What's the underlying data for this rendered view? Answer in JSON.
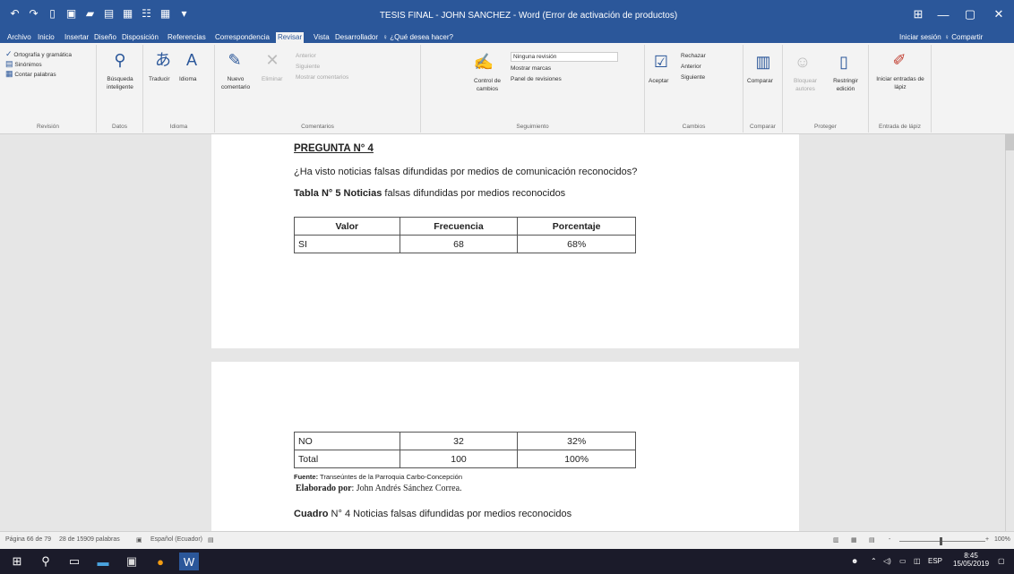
{
  "window": {
    "title": "TESIS FINAL - JOHN SÁNCHEZ - Word (Error de activación de productos)",
    "minimize": "—",
    "maximize": "▢",
    "close": "✕",
    "ribbon_display": "⊞"
  },
  "qat": [
    "5",
    "·",
    "◯",
    "▢",
    "⤺",
    "▪",
    "▪",
    "▤",
    "▤",
    "▤",
    "▾"
  ],
  "tabs": [
    {
      "label": "Archivo"
    },
    {
      "label": "Inicio"
    },
    {
      "label": "Insertar"
    },
    {
      "label": "Diseño"
    },
    {
      "label": "Disposición"
    },
    {
      "label": "Referencias"
    },
    {
      "label": "Correspondencia"
    },
    {
      "label": "Revisar",
      "active": true
    },
    {
      "label": "Vista"
    },
    {
      "label": "Desarrollador"
    },
    {
      "label": "♀ ¿Qué desea hacer?"
    }
  ],
  "account": {
    "signin": "Iniciar sesión",
    "share": "♀ Compartir"
  },
  "ribbon": {
    "revision": {
      "label": "Revisión",
      "spelling": "Ortografía y gramática",
      "thesaurus": "Sinónimos",
      "word_count": "Contar palabras"
    },
    "ideas": {
      "label": "Datos",
      "smart_lookup": "Búsqueda inteligente"
    },
    "language": {
      "label": "Idioma",
      "translate": "Traducir",
      "language": "Idioma"
    },
    "comments": {
      "label": "Comentarios",
      "new": "Nuevo comentario",
      "delete": "Eliminar",
      "previous": "Anterior",
      "next": "Siguiente",
      "show": "Mostrar comentarios"
    },
    "tracking": {
      "label": "Seguimiento",
      "track_changes": "Control de cambios",
      "markup_select": "Ninguna revisión",
      "show_markup": "Mostrar marcas",
      "reviewing_pane": "Panel de revisiones"
    },
    "changes": {
      "label": "Cambios",
      "accept": "Aceptar",
      "reject": "Rechazar",
      "previous": "Anterior",
      "next": "Siguiente"
    },
    "compare": {
      "label": "Comparar",
      "compare": "Comparar"
    },
    "protect": {
      "label": "Proteger",
      "block_authors": "Bloquear autores",
      "restrict": "Restringir edición"
    },
    "ink": {
      "label": "Entrada de lápiz",
      "start_ink": "Iniciar entradas de lápiz"
    }
  },
  "document": {
    "page1": {
      "heading": "PREGUNTA N° 4",
      "question": "¿Ha visto noticias falsas difundidas por medios de comunicación reconocidos?",
      "caption_bold": "Tabla N° 5 Noticias",
      "caption_rest": " falsas difundidas por medios reconocidos",
      "table": {
        "headers": [
          "Valor",
          "Frecuencia",
          "Porcentaje"
        ],
        "rows": [
          [
            "SI",
            "68",
            "68%"
          ]
        ]
      }
    },
    "page2": {
      "table": {
        "rows": [
          [
            "NO",
            "32",
            "32%"
          ],
          [
            "Total",
            "100",
            "100%"
          ]
        ]
      },
      "source_bold": "Fuente:",
      "source_rest": " Transeúntes de la Parroquia Carbo-Concepción",
      "author_bold": "Elaborado por",
      "author_rest": ": John Andrés Sánchez Correa.",
      "caption_bold": "Cuadro",
      "caption_rest": " N° 4 Noticias falsas difundidas por medios reconocidos"
    }
  },
  "statusbar": {
    "page": "Página 66 de 79",
    "words": "28 de 15909 palabras",
    "language": "Español (Ecuador)",
    "zoom": "100%",
    "zoom_minus": "-",
    "zoom_plus": "+"
  },
  "taskbar": {
    "time": "8:45",
    "date": "15/05/2019",
    "lang": "ESP"
  }
}
